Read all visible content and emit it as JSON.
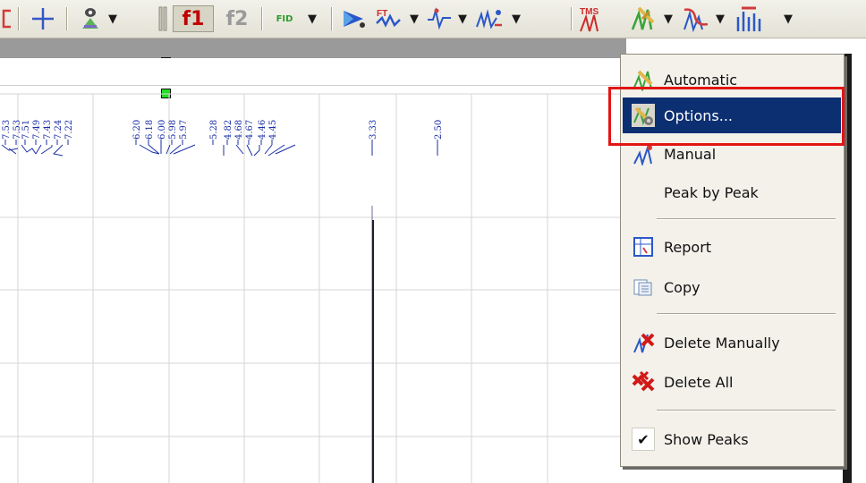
{
  "toolbar": {
    "f1_label": "f1",
    "f2_label": "f2",
    "fid_label": "FID",
    "tms_label": "TMS",
    "icons": [
      "partial-bracket-icon",
      "crosshair-icon",
      "eye-icon",
      "splitter-handle-icon",
      "process-arrow-icon",
      "fourier-transform-icon",
      "phase-correction-icon",
      "baseline-icon",
      "reference-icon",
      "peak-picking-icon",
      "integration-icon",
      "multiplet-icon"
    ]
  },
  "spectrum": {
    "peak_labels": [
      "7.53",
      "7.53",
      "7.51",
      "7.49",
      "7.43",
      "7.24",
      "7.22",
      "6.20",
      "6.18",
      "6.00",
      "5.98",
      "5.97",
      "5.28",
      "4.82",
      "4.68",
      "4.67",
      "4.46",
      "4.45",
      "3.33",
      "2.50"
    ],
    "first_label_partial": "7.53"
  },
  "menu": {
    "items": [
      {
        "label": "Automatic",
        "icon": "peak-automatic-icon"
      },
      {
        "label": "Options...",
        "icon": "peak-options-icon",
        "selected": true
      },
      {
        "label": "Manual",
        "icon": "peak-manual-icon"
      },
      {
        "label": "Peak by Peak",
        "icon": ""
      },
      {
        "label": "Report",
        "icon": "report-icon"
      },
      {
        "label": "Copy",
        "icon": "copy-icon"
      },
      {
        "label": "Delete Manually",
        "icon": "delete-manually-icon"
      },
      {
        "label": "Delete All",
        "icon": "delete-all-icon"
      },
      {
        "label": "Show Peaks",
        "icon": "checkmark-icon",
        "checked": true
      }
    ]
  },
  "colors": {
    "menu_selection": "#0c2f72",
    "highlight_box": "#e21414",
    "peak_label": "#1b2fa6"
  }
}
